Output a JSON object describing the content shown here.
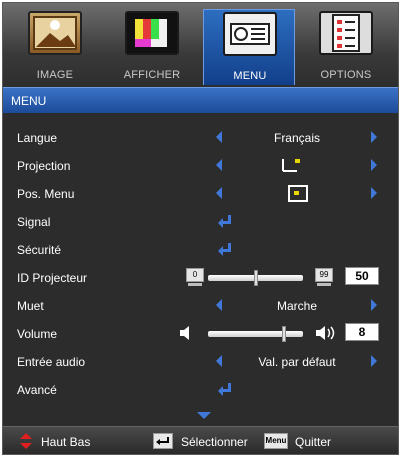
{
  "tabs": [
    {
      "label": "IMAGE",
      "icon": "image-icon",
      "active": false
    },
    {
      "label": "AFFICHER",
      "icon": "display-icon",
      "active": false
    },
    {
      "label": "MENU",
      "icon": "projector-icon",
      "active": true
    },
    {
      "label": "OPTIONS",
      "icon": "options-icon",
      "active": false
    }
  ],
  "header": {
    "title": "MENU"
  },
  "items": {
    "langue": {
      "label": "Langue",
      "value": "Français"
    },
    "projection": {
      "label": "Projection"
    },
    "pos_menu": {
      "label": "Pos. Menu"
    },
    "signal": {
      "label": "Signal"
    },
    "securite": {
      "label": "Sécurité"
    },
    "id_projecteur": {
      "label": "ID Projecteur",
      "min": "0",
      "max": "99",
      "value": "50",
      "fraction": 0.5
    },
    "muet": {
      "label": "Muet",
      "value": "Marche"
    },
    "volume": {
      "label": "Volume",
      "value": "8",
      "fraction": 0.8
    },
    "entree_audio": {
      "label": "Entrée audio",
      "value": "Val. par défaut"
    },
    "avance": {
      "label": "Avancé"
    }
  },
  "footer": {
    "nav_label": "Haut Bas",
    "select_label": "Sélectionner",
    "menu_key": "Menu",
    "quit_label": "Quitter"
  },
  "colors": {
    "accent": "#3f78d8",
    "header": "#1c4b9a",
    "background": "#2c2c2c"
  }
}
